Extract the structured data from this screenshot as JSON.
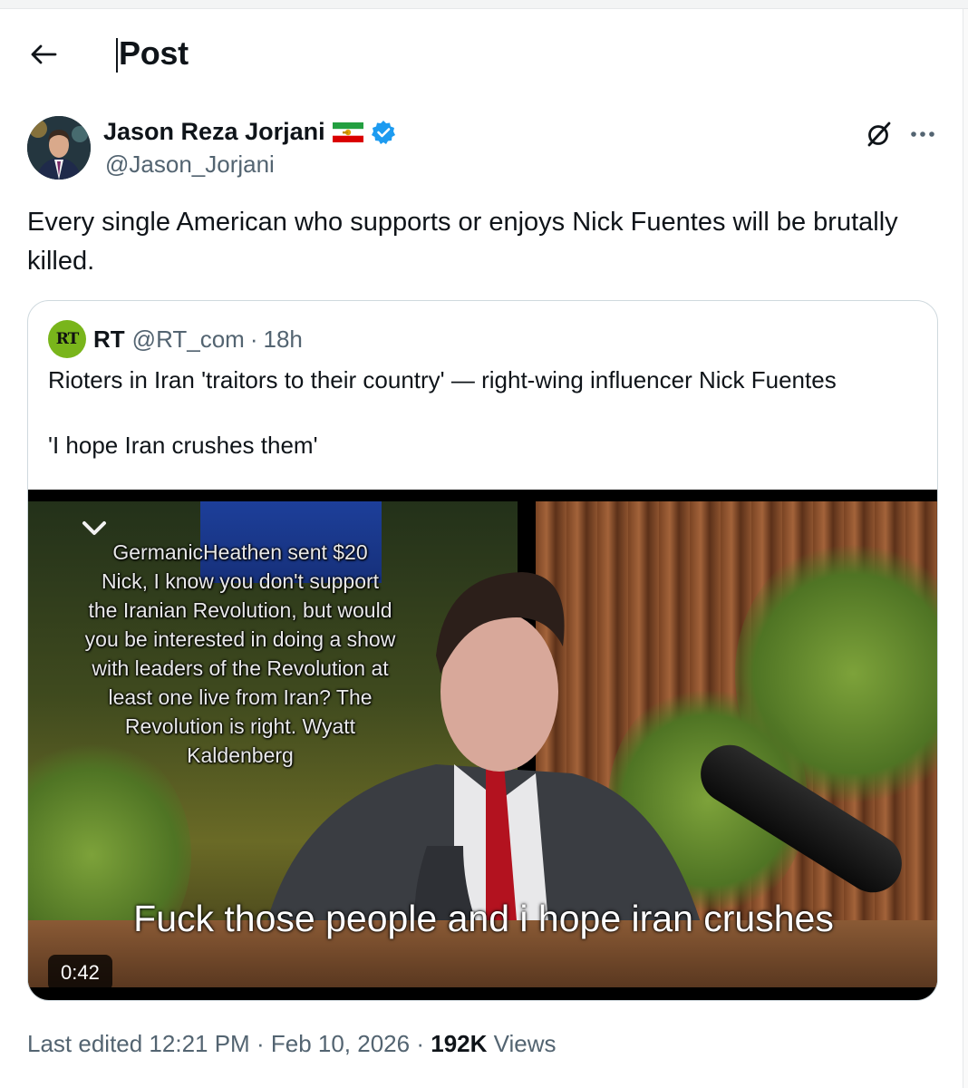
{
  "header": {
    "title": "Post",
    "back_icon": "arrow-left-icon"
  },
  "author": {
    "display_name": "Jason Reza Jorjani",
    "handle": "@Jason_Jorjani",
    "flag_icon": "iran-lion-and-sun-flag-icon",
    "verified_icon": "verified-badge-icon",
    "verified_color": "#1d9bf0"
  },
  "post": {
    "text": "Every single American who supports or enjoys Nick Fuentes will be brutally killed."
  },
  "quote": {
    "name": "RT",
    "handle": "@RT_com",
    "separator": "·",
    "time": "18h",
    "logo_text": "RT",
    "logo_color": "#79b51b",
    "text_line1": "Rioters in Iran 'traitors to their country' — right-wing influencer Nick Fuentes",
    "text_line2": "'I hope Iran crushes them'",
    "video": {
      "overlay_lines": [
        "GermanicHeathen sent $20",
        "Nick, I know you don't support",
        "the Iranian Revolution, but would",
        "you be interested in doing a show",
        "with leaders of the Revolution at",
        "least one live from Iran? The",
        "Revolution is right. Wyatt",
        "Kaldenberg"
      ],
      "caption": "Fuck those people and i hope iran crushes",
      "duration": "0:42"
    }
  },
  "meta": {
    "edited_label": "Last edited 12:21 PM",
    "separator": "·",
    "date": "Feb 10, 2026",
    "views_count": "192K",
    "views_label": "Views"
  },
  "icons": {
    "grok": "grok-icon",
    "more": "more-options-icon"
  }
}
